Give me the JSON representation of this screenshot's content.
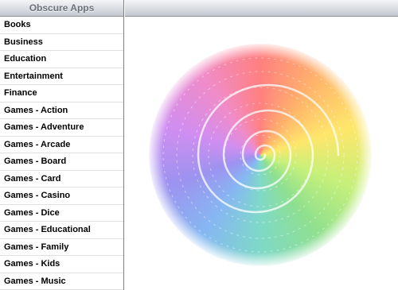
{
  "sidebar": {
    "title": "Obscure Apps",
    "items": [
      {
        "label": "Books"
      },
      {
        "label": "Business"
      },
      {
        "label": "Education"
      },
      {
        "label": "Entertainment"
      },
      {
        "label": "Finance"
      },
      {
        "label": "Games - Action"
      },
      {
        "label": "Games - Adventure"
      },
      {
        "label": "Games - Arcade"
      },
      {
        "label": "Games - Board"
      },
      {
        "label": "Games - Card"
      },
      {
        "label": "Games - Casino"
      },
      {
        "label": "Games - Dice"
      },
      {
        "label": "Games - Educational"
      },
      {
        "label": "Games - Family"
      },
      {
        "label": "Games - Kids"
      },
      {
        "label": "Games - Music"
      }
    ]
  },
  "detail": {
    "image": "rainbow-spiral-loading-image"
  },
  "colors": {
    "header_text": "#6b717a",
    "list_text": "#000000",
    "divider": "#e0e0e0"
  }
}
